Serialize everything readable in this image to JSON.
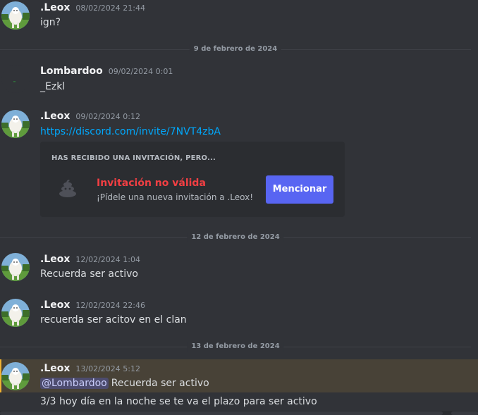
{
  "messages": {
    "m1": {
      "username": ".Leox",
      "timestamp": "08/02/2024 21:44",
      "text": "ign?"
    },
    "m2": {
      "username": "Lombardoo",
      "timestamp": "09/02/2024 0:01",
      "text": "_Ezkl"
    },
    "m3": {
      "username": ".Leox",
      "timestamp": "09/02/2024 0:12",
      "link": "https://discord.com/invite/7NVT4zbA"
    },
    "m4": {
      "username": ".Leox",
      "timestamp": "12/02/2024 1:04",
      "text": "Recuerda ser activo"
    },
    "m5": {
      "username": ".Leox",
      "timestamp": "12/02/2024 22:46",
      "text": "recuerda ser acitov en el clan"
    },
    "m6": {
      "username": ".Leox",
      "timestamp": "13/02/2024 5:12",
      "mention": "@Lombardoo",
      "text": "Recuerda ser activo"
    },
    "m7": {
      "text": "3/3 hoy día en la noche se te va el plazo para ser activo"
    }
  },
  "dividers": {
    "d1": "9 de febrero de 2024",
    "d2": "12 de febrero de 2024",
    "d3": "13 de febrero de 2024"
  },
  "invite": {
    "heading": "HAS RECIBIDO UNA INVITACIÓN, PERO...",
    "title": "Invitación no válida",
    "description": "¡Pídele una nueva invitación a .Leox!",
    "button": "Mencionar"
  },
  "colors": {
    "background": "#313338",
    "card": "#2b2d31",
    "accent": "#5865f2",
    "error": "#f23f43",
    "link": "#00a8fc",
    "mention_highlight": "#f0b232"
  },
  "icons": {
    "avatar": "white-llama-avatar",
    "invite_icon": "poop-icon"
  }
}
